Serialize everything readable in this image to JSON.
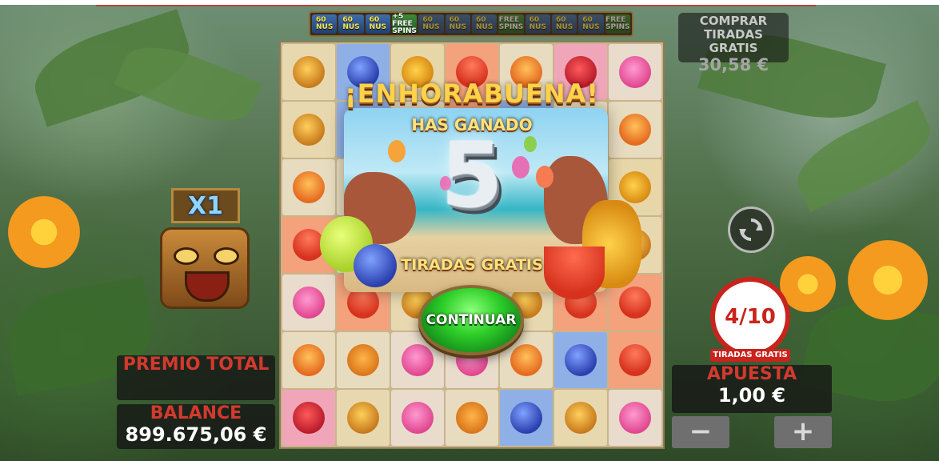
{
  "ticker": {
    "items": [
      {
        "label": "60\nNUS",
        "kind": "bonus"
      },
      {
        "label": "60\nNUS",
        "kind": "bonus"
      },
      {
        "label": "60\nNUS",
        "kind": "bonus"
      },
      {
        "label": "+5\nFREE\nSPINS",
        "kind": "fs"
      },
      {
        "label": "60\nNUS",
        "kind": "bonus-dim"
      },
      {
        "label": "60\nNUS",
        "kind": "bonus-dim"
      },
      {
        "label": "60\nNUS",
        "kind": "bonus-dim"
      },
      {
        "label": "FREE\nSPINS",
        "kind": "fs-dim"
      },
      {
        "label": "60\nNUS",
        "kind": "bonus-dim"
      },
      {
        "label": "60\nNUS",
        "kind": "bonus-dim"
      },
      {
        "label": "60\nNUS",
        "kind": "bonus-dim"
      },
      {
        "label": "FREE\nSPINS",
        "kind": "fs-dim"
      }
    ]
  },
  "popup": {
    "title": "¡ENHORABUENA!",
    "subtitle": "HAS GANADO",
    "amount": "5",
    "label": "TIRADAS GRATIS",
    "button": "CONTINUAR"
  },
  "multiplier": "X1",
  "premio": {
    "title": "PREMIO TOTAL",
    "value": ""
  },
  "balance": {
    "title": "BALANCE",
    "value": "899.675,06 €"
  },
  "buy": {
    "title": "COMPRAR\nTIRADAS GRATIS",
    "price": "30,58 €"
  },
  "free_spins_counter": {
    "value": "4/10",
    "label": "TIRADAS GRATIS"
  },
  "bet": {
    "title": "APUESTA",
    "value": "1,00 €",
    "minus": "−",
    "plus": "+"
  },
  "grid": {
    "rows": [
      [
        "muffin",
        "blueberry",
        "pineapple",
        "watermelon",
        "cocktail",
        "strawberry",
        "flamingo"
      ],
      [
        "muffin",
        "blueberry",
        "glasses",
        "watermelon",
        "blueberry",
        "glasses",
        "cocktail"
      ],
      [
        "cocktail",
        "cocktail",
        "blueberry",
        "blueberry",
        "muffin",
        "pineapple",
        "pineapple"
      ],
      [
        "watermelon",
        "lime",
        "blueberry",
        "watermelon",
        "watermelon",
        "pineapple",
        "muffin"
      ],
      [
        "flamingo",
        "watermelon",
        "muffin",
        "blueberry",
        "muffin",
        "watermelon",
        "watermelon"
      ],
      [
        "cocktail",
        "glasses",
        "flamingo",
        "flamingo",
        "cocktail",
        "blueberry",
        "watermelon"
      ],
      [
        "strawberry",
        "muffin",
        "flamingo",
        "glasses",
        "blueberry",
        "muffin",
        "flamingo"
      ]
    ]
  },
  "colors": {
    "accent": "#c8241d",
    "gold": "#ffd24a",
    "button_green": "#2fd02a"
  }
}
